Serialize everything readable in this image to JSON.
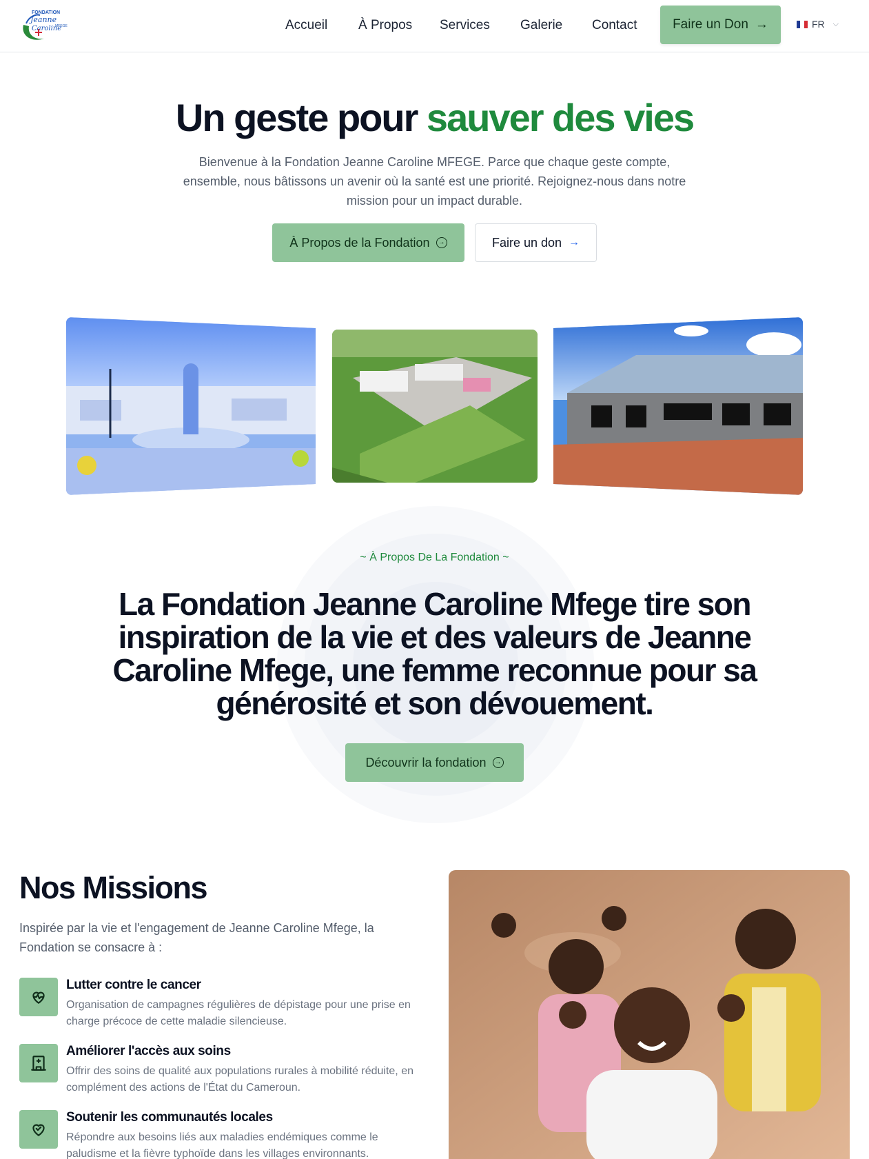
{
  "header": {
    "logo_text": [
      "FONDATION",
      "Jeanne",
      "Caroline",
      "MFEGE"
    ],
    "nav": [
      "Accueil",
      "À Propos",
      "Services",
      "Galerie",
      "Contact"
    ],
    "donate_label": "Faire un Don",
    "lang_label": "FR"
  },
  "hero": {
    "title_main": "Un geste pour ",
    "title_accent": "sauver des vies",
    "subtitle": "Bienvenue à la Fondation Jeanne Caroline MFEGE. Parce que chaque geste compte, ensemble, nous bâtissons un avenir où la santé est une priorité. Rejoignez-nous dans notre mission pour un impact durable.",
    "btn_about": "À Propos de la Fondation",
    "btn_donate": "Faire un don"
  },
  "about": {
    "tag": "~  À Propos De La Fondation  ~",
    "title": "La Fondation Jeanne Caroline Mfege tire son inspiration de la vie et des valeurs de Jeanne Caroline Mfege, une femme reconnue pour sa générosité et son dévouement.",
    "button": "Découvrir la fondation"
  },
  "missions": {
    "title": "Nos Missions",
    "intro": "Inspirée par la vie et l'engagement de Jeanne Caroline Mfege, la Fondation se consacre à :",
    "items": [
      {
        "title": "Lutter contre le cancer",
        "desc": "Organisation de campagnes régulières de dépistage pour une prise en charge précoce de cette maladie silencieuse.",
        "icon": "heart-pulse-icon"
      },
      {
        "title": "Améliorer l'accès aux soins",
        "desc": "Offrir des soins de qualité aux populations rurales à mobilité réduite, en complément des actions de l'État du Cameroun.",
        "icon": "hospital-icon"
      },
      {
        "title": "Soutenir les communautés locales",
        "desc": "Répondre aux besoins liés aux maladies endémiques comme le paludisme et la fièvre typhoïde dans les villages environnants.",
        "icon": "heart-handshake-icon"
      }
    ]
  },
  "colors": {
    "accent_green": "#1f8a3d",
    "button_green": "#8fc49a",
    "dark_text": "#0c1222"
  }
}
